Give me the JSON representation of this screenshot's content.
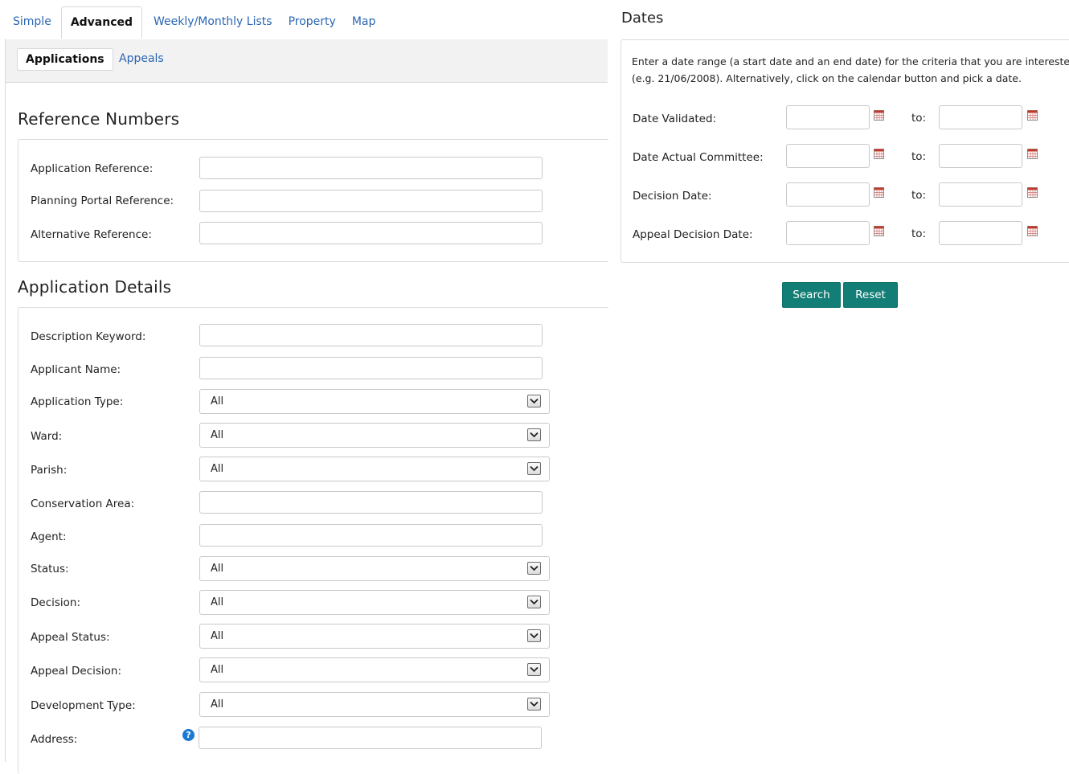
{
  "top_tabs": [
    {
      "label": "Simple",
      "active": false
    },
    {
      "label": "Advanced",
      "active": true
    },
    {
      "label": "Weekly/Monthly Lists",
      "active": false
    },
    {
      "label": "Property",
      "active": false
    },
    {
      "label": "Map",
      "active": false
    }
  ],
  "sub_tabs": [
    {
      "label": "Applications",
      "active": true
    },
    {
      "label": "Appeals",
      "active": false
    }
  ],
  "reference_numbers": {
    "title": "Reference Numbers",
    "fields": [
      {
        "label": "Application Reference:",
        "value": ""
      },
      {
        "label": "Planning Portal Reference:",
        "value": ""
      },
      {
        "label": "Alternative Reference:",
        "value": ""
      }
    ]
  },
  "application_details": {
    "title": "Application Details",
    "fields": [
      {
        "label": "Description Keyword:",
        "type": "text",
        "value": ""
      },
      {
        "label": "Applicant Name:",
        "type": "text",
        "value": ""
      },
      {
        "label": "Application Type:",
        "type": "select",
        "value": "All"
      },
      {
        "label": "Ward:",
        "type": "select",
        "value": "All"
      },
      {
        "label": "Parish:",
        "type": "select",
        "value": "All"
      },
      {
        "label": "Conservation Area:",
        "type": "text",
        "value": ""
      },
      {
        "label": "Agent:",
        "type": "text",
        "value": ""
      },
      {
        "label": "Status:",
        "type": "select",
        "value": "All"
      },
      {
        "label": "Decision:",
        "type": "select",
        "value": "All"
      },
      {
        "label": "Appeal Status:",
        "type": "select",
        "value": "All"
      },
      {
        "label": "Appeal Decision:",
        "type": "select",
        "value": "All"
      },
      {
        "label": "Development Type:",
        "type": "select",
        "value": "All"
      },
      {
        "label": "Address:",
        "type": "text",
        "value": ""
      }
    ],
    "help_icon": "?"
  },
  "dates": {
    "title": "Dates",
    "instructions_line1": "Enter a date range (a start date and an end date) for the criteria that you are interested in. T",
    "instructions_line2": "(e.g. 21/06/2008). Alternatively, click on the calendar button and pick a date.",
    "to_label": "to:",
    "rows": [
      {
        "label": "Date Validated:",
        "from": "",
        "to": ""
      },
      {
        "label": "Date Actual Committee:",
        "from": "",
        "to": ""
      },
      {
        "label": "Decision Date:",
        "from": "",
        "to": ""
      },
      {
        "label": "Appeal Decision Date:",
        "from": "",
        "to": ""
      }
    ]
  },
  "buttons": {
    "search": "Search",
    "reset": "Reset"
  },
  "icons": {
    "calendar": "calendar-icon",
    "dropdown": "chevron-down-icon",
    "help": "help-icon"
  },
  "colors": {
    "link": "#2a66b3",
    "button": "#137e76",
    "help": "#1a7ad3",
    "calendar": "#c0392b"
  }
}
